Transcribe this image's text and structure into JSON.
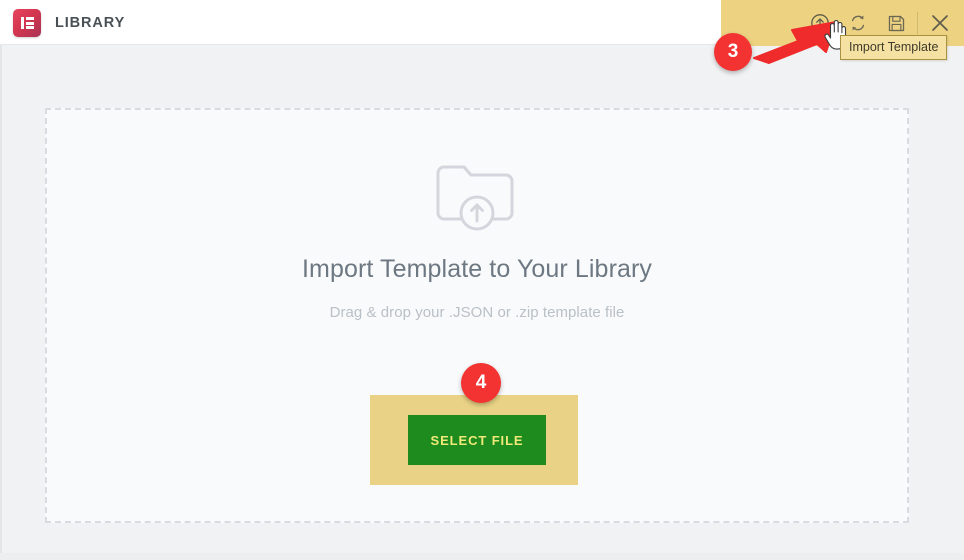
{
  "window": {
    "background_color": "#f1f2f3"
  },
  "header": {
    "title": "LIBRARY",
    "logo_icon": "elementor-logo-icon",
    "brand_color": "#d4364f",
    "highlight_color": "#edd282",
    "actions": [
      {
        "id": "import-template",
        "icon": "import-upload-circle-icon",
        "label": "Import Template"
      },
      {
        "id": "sync-library",
        "icon": "sync-refresh-icon",
        "label": "Sync Library"
      },
      {
        "id": "save-template",
        "icon": "floppy-save-icon",
        "label": "Save"
      },
      {
        "id": "close-panel",
        "icon": "close-x-icon",
        "label": "Close"
      }
    ],
    "tooltip": "Import Template"
  },
  "callouts": [
    {
      "id": "step-3",
      "number": "3",
      "color": "#f33232"
    },
    {
      "id": "step-4",
      "number": "4",
      "color": "#f33232"
    }
  ],
  "main": {
    "dropzone": {
      "icon": "folder-upload-icon",
      "title": "Import Template to Your Library",
      "subtitle": "Drag & drop your .JSON or .zip template file",
      "border_style": "dashed",
      "border_color": "#d8dbe0",
      "background_color": "#f9fafb"
    },
    "select_file_button": {
      "label": "SELECT FILE",
      "background_color": "#1d8b1d",
      "text_color": "#f0e97a",
      "highlight_color": "#e9d285"
    }
  }
}
